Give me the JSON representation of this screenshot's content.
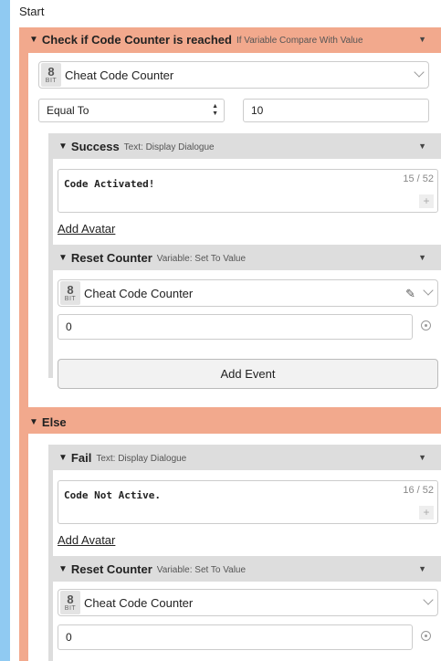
{
  "start_label": "Start",
  "if_event": {
    "title": "Check if Code Counter is reached",
    "subtitle": "If Variable Compare With Value",
    "variable": {
      "bit": "8",
      "bit_word": "BIT",
      "name": "Cheat Code Counter"
    },
    "comparison": "Equal To",
    "value": "10",
    "success": {
      "title": "Success",
      "subtitle": "Text: Display Dialogue",
      "text": "Code Activated!",
      "counter": "15 / 52",
      "add_avatar": "Add Avatar"
    },
    "reset": {
      "title": "Reset Counter",
      "subtitle": "Variable: Set To Value",
      "variable": {
        "bit": "8",
        "bit_word": "BIT",
        "name": "Cheat Code Counter"
      },
      "value": "0"
    },
    "add_event": "Add Event"
  },
  "else_event": {
    "title": "Else",
    "fail": {
      "title": "Fail",
      "subtitle": "Text: Display Dialogue",
      "text": "Code Not Active.",
      "counter": "16 / 52",
      "add_avatar": "Add Avatar"
    },
    "reset": {
      "title": "Reset Counter",
      "subtitle": "Variable: Set To Value",
      "variable": {
        "bit": "8",
        "bit_word": "BIT",
        "name": "Cheat Code Counter"
      },
      "value": "0"
    }
  },
  "colors": {
    "accent": "#f2a98d",
    "rail": "#90caf2",
    "sub_header": "#dddddd"
  },
  "icons": [
    "caret-down-icon",
    "kebab-icon",
    "chevron-down-icon",
    "pencil-icon",
    "target-icon",
    "plus-icon",
    "updown-icon"
  ]
}
